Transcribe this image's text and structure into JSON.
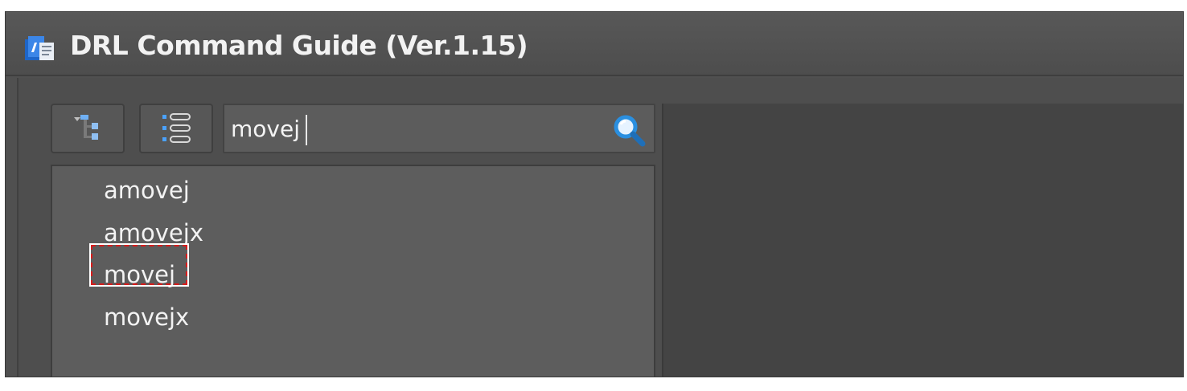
{
  "window": {
    "title": "DRL Command Guide (Ver.1.15)",
    "icon": "app-icon"
  },
  "toolbar": {
    "tree_view_icon": "tree-view-icon",
    "list_view_icon": "list-view-icon"
  },
  "search": {
    "value": "movej",
    "placeholder": "",
    "icon": "search-icon"
  },
  "results": {
    "items": [
      "amovej",
      "amovejx",
      "movej",
      "movejx"
    ],
    "highlighted_item": "movej"
  },
  "colors": {
    "window_bg": "#505050",
    "text": "#f2f2f2",
    "highlight_border": "#d81b1b",
    "search_icon": "#2a8fe0"
  }
}
